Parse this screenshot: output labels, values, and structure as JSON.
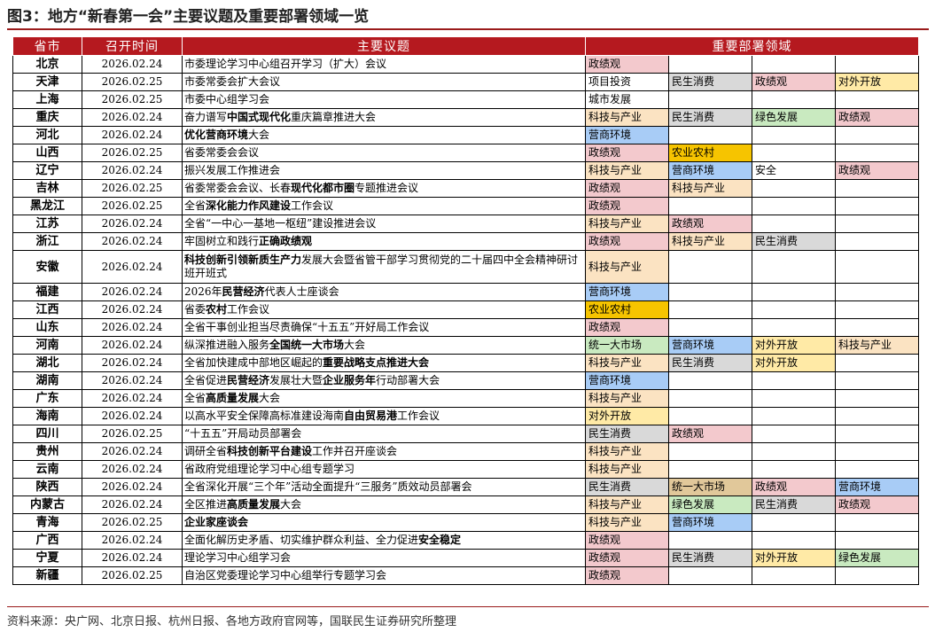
{
  "title": "图3：地方“新春第一会”主要议题及重要部署领域一览",
  "source": "资料来源：央广网、北京日报、杭州日报、各地方政府官网等，国联民生证券研究所整理",
  "headers": [
    "省市",
    "召开时间",
    "主要议题",
    "重要部署领域"
  ],
  "colors": {
    "header": "#b5191f",
    "rule": "#9a1b1b",
    "pink": "#f3c9cd",
    "orange": "#fbe3c2",
    "green": "#c9eac0",
    "blue": "#a8ccf6",
    "yellow": "#ffeaa6",
    "gray": "#d9d9d9",
    "gold": "#f6c400",
    "tan": "#e1c89a"
  },
  "rows": [
    {
      "prov": "北京",
      "date": "2026.02.24",
      "topic": [
        {
          "t": "市委理论学习中心组召开学习（扩大）会议"
        }
      ],
      "domains": [
        {
          "t": "政绩观",
          "c": "pink"
        },
        {
          "t": "",
          "c": "white"
        },
        {
          "t": "",
          "c": "white"
        },
        {
          "t": "",
          "c": "white"
        }
      ]
    },
    {
      "prov": "天津",
      "date": "2026.02.25",
      "topic": [
        {
          "t": "市委常委会扩大会议"
        }
      ],
      "domains": [
        {
          "t": "项目投资",
          "c": "white"
        },
        {
          "t": "民生消费",
          "c": "gray"
        },
        {
          "t": "政绩观",
          "c": "pink"
        },
        {
          "t": "对外开放",
          "c": "yellow"
        }
      ]
    },
    {
      "prov": "上海",
      "date": "2026.02.25",
      "topic": [
        {
          "t": "市委中心组学习会"
        }
      ],
      "domains": [
        {
          "t": "城市发展",
          "c": "white"
        },
        {
          "t": "",
          "c": "white"
        },
        {
          "t": "",
          "c": "white"
        },
        {
          "t": "",
          "c": "white"
        }
      ]
    },
    {
      "prov": "重庆",
      "date": "2026.02.24",
      "topic": [
        {
          "t": "奋力谱写"
        },
        {
          "t": "中国式现代化",
          "b": true
        },
        {
          "t": "重庆篇章推进大会"
        }
      ],
      "domains": [
        {
          "t": "科技与产业",
          "c": "orange"
        },
        {
          "t": "民生消费",
          "c": "gray"
        },
        {
          "t": "绿色发展",
          "c": "green"
        },
        {
          "t": "政绩观",
          "c": "pink"
        }
      ]
    },
    {
      "prov": "河北",
      "date": "2026.02.24",
      "topic": [
        {
          "t": "优化营商环境",
          "b": true
        },
        {
          "t": "大会"
        }
      ],
      "domains": [
        {
          "t": "营商环境",
          "c": "blue"
        },
        {
          "t": "",
          "c": "white"
        },
        {
          "t": "",
          "c": "white"
        },
        {
          "t": "",
          "c": "white"
        }
      ]
    },
    {
      "prov": "山西",
      "date": "2026.02.25",
      "topic": [
        {
          "t": "省委常委会会议"
        }
      ],
      "domains": [
        {
          "t": "政绩观",
          "c": "pink"
        },
        {
          "t": "农业农村",
          "c": "gold"
        },
        {
          "t": "",
          "c": "white"
        },
        {
          "t": "",
          "c": "white"
        }
      ]
    },
    {
      "prov": "辽宁",
      "date": "2026.02.24",
      "topic": [
        {
          "t": "振兴发展工作推进会"
        }
      ],
      "domains": [
        {
          "t": "科技与产业",
          "c": "orange"
        },
        {
          "t": "营商环境",
          "c": "blue"
        },
        {
          "t": "安全",
          "c": "white"
        },
        {
          "t": "政绩观",
          "c": "pink"
        }
      ]
    },
    {
      "prov": "吉林",
      "date": "2026.02.25",
      "topic": [
        {
          "t": "省委常委会会议、长春"
        },
        {
          "t": "现代化都市圈",
          "b": true
        },
        {
          "t": "专题推进会议"
        }
      ],
      "domains": [
        {
          "t": "政绩观",
          "c": "pink"
        },
        {
          "t": "科技与产业",
          "c": "orange"
        },
        {
          "t": "",
          "c": "white"
        },
        {
          "t": "",
          "c": "white"
        }
      ]
    },
    {
      "prov": "黑龙江",
      "date": "2026.02.25",
      "topic": [
        {
          "t": "全省"
        },
        {
          "t": "深化能力作风建设",
          "b": true
        },
        {
          "t": "工作会议"
        }
      ],
      "domains": [
        {
          "t": "政绩观",
          "c": "pink"
        },
        {
          "t": "",
          "c": "white"
        },
        {
          "t": "",
          "c": "white"
        },
        {
          "t": "",
          "c": "white"
        }
      ]
    },
    {
      "prov": "江苏",
      "date": "2026.02.24",
      "topic": [
        {
          "t": "全省“一中心一基地一枢纽”建设推进会议"
        }
      ],
      "domains": [
        {
          "t": "科技与产业",
          "c": "orange"
        },
        {
          "t": "政绩观",
          "c": "pink"
        },
        {
          "t": "",
          "c": "white"
        },
        {
          "t": "",
          "c": "white"
        }
      ]
    },
    {
      "prov": "浙江",
      "date": "2026.02.24",
      "topic": [
        {
          "t": "牢固树立和践行"
        },
        {
          "t": "正确政绩观",
          "b": true
        }
      ],
      "domains": [
        {
          "t": "政绩观",
          "c": "pink"
        },
        {
          "t": "科技与产业",
          "c": "orange"
        },
        {
          "t": "民生消费",
          "c": "gray"
        },
        {
          "t": "",
          "c": "white"
        }
      ]
    },
    {
      "prov": "安徽",
      "date": "2026.02.24",
      "tall": true,
      "topic": [
        {
          "t": "科技创新引领新质生产力",
          "b": true
        },
        {
          "t": "发展大会暨省管干部学习贯彻党的二十届四中全会精神研讨班开班式"
        }
      ],
      "domains": [
        {
          "t": "科技与产业",
          "c": "orange"
        },
        {
          "t": "",
          "c": "white"
        },
        {
          "t": "",
          "c": "white"
        },
        {
          "t": "",
          "c": "white"
        }
      ]
    },
    {
      "prov": "福建",
      "date": "2026.02.24",
      "topic": [
        {
          "t": "2026年"
        },
        {
          "t": "民营经济",
          "b": true
        },
        {
          "t": "代表人士座谈会"
        }
      ],
      "domains": [
        {
          "t": "营商环境",
          "c": "blue"
        },
        {
          "t": "",
          "c": "white"
        },
        {
          "t": "",
          "c": "white"
        },
        {
          "t": "",
          "c": "white"
        }
      ]
    },
    {
      "prov": "江西",
      "date": "2026.02.24",
      "topic": [
        {
          "t": "省委"
        },
        {
          "t": "农村",
          "b": true
        },
        {
          "t": "工作会议"
        }
      ],
      "domains": [
        {
          "t": "农业农村",
          "c": "gold"
        },
        {
          "t": "",
          "c": "white"
        },
        {
          "t": "",
          "c": "white"
        },
        {
          "t": "",
          "c": "white"
        }
      ]
    },
    {
      "prov": "山东",
      "date": "2026.02.24",
      "topic": [
        {
          "t": "全省干事创业担当尽责确保“十五五”开好局工作会议"
        }
      ],
      "domains": [
        {
          "t": "政绩观",
          "c": "pink"
        },
        {
          "t": "",
          "c": "white"
        },
        {
          "t": "",
          "c": "white"
        },
        {
          "t": "",
          "c": "white"
        }
      ]
    },
    {
      "prov": "河南",
      "date": "2026.02.24",
      "topic": [
        {
          "t": "纵深推进融入服务"
        },
        {
          "t": "全国统一大市场",
          "b": true
        },
        {
          "t": "大会"
        }
      ],
      "domains": [
        {
          "t": "统一大市场",
          "c": "green"
        },
        {
          "t": "营商环境",
          "c": "blue"
        },
        {
          "t": "对外开放",
          "c": "yellow"
        },
        {
          "t": "科技与产业",
          "c": "orange"
        }
      ]
    },
    {
      "prov": "湖北",
      "date": "2026.02.24",
      "topic": [
        {
          "t": "全省加快建成中部地区崛起的"
        },
        {
          "t": "重要战略支点推进大会",
          "b": true
        }
      ],
      "domains": [
        {
          "t": "科技与产业",
          "c": "orange"
        },
        {
          "t": "民生消费",
          "c": "gray"
        },
        {
          "t": "对外开放",
          "c": "yellow"
        },
        {
          "t": "",
          "c": "white"
        }
      ]
    },
    {
      "prov": "湖南",
      "date": "2026.02.24",
      "topic": [
        {
          "t": "全省促进"
        },
        {
          "t": "民营经济",
          "b": true
        },
        {
          "t": "发展壮大暨"
        },
        {
          "t": "企业服务年",
          "b": true
        },
        {
          "t": "行动部署大会"
        }
      ],
      "domains": [
        {
          "t": "营商环境",
          "c": "blue"
        },
        {
          "t": "",
          "c": "white"
        },
        {
          "t": "",
          "c": "white"
        },
        {
          "t": "",
          "c": "white"
        }
      ]
    },
    {
      "prov": "广东",
      "date": "2026.02.24",
      "topic": [
        {
          "t": "全省"
        },
        {
          "t": "高质量发展",
          "b": true
        },
        {
          "t": "大会"
        }
      ],
      "domains": [
        {
          "t": "科技与产业",
          "c": "orange"
        },
        {
          "t": "",
          "c": "white"
        },
        {
          "t": "",
          "c": "white"
        },
        {
          "t": "",
          "c": "white"
        }
      ]
    },
    {
      "prov": "海南",
      "date": "2026.02.24",
      "topic": [
        {
          "t": "以高水平安全保障高标准建设海南"
        },
        {
          "t": "自由贸易港",
          "b": true
        },
        {
          "t": "工作会议"
        }
      ],
      "domains": [
        {
          "t": "对外开放",
          "c": "yellow"
        },
        {
          "t": "",
          "c": "white"
        },
        {
          "t": "",
          "c": "white"
        },
        {
          "t": "",
          "c": "white"
        }
      ]
    },
    {
      "prov": "四川",
      "date": "2026.02.25",
      "topic": [
        {
          "t": "“十五五”开局动员部署会"
        }
      ],
      "domains": [
        {
          "t": "民生消费",
          "c": "gray"
        },
        {
          "t": "政绩观",
          "c": "pink"
        },
        {
          "t": "",
          "c": "white"
        },
        {
          "t": "",
          "c": "white"
        }
      ]
    },
    {
      "prov": "贵州",
      "date": "2026.02.24",
      "topic": [
        {
          "t": "调研全省"
        },
        {
          "t": "科技创新平台建设",
          "b": true
        },
        {
          "t": "工作并召开座谈会"
        }
      ],
      "domains": [
        {
          "t": "科技与产业",
          "c": "orange"
        },
        {
          "t": "",
          "c": "white"
        },
        {
          "t": "",
          "c": "white"
        },
        {
          "t": "",
          "c": "white"
        }
      ]
    },
    {
      "prov": "云南",
      "date": "2026.02.24",
      "topic": [
        {
          "t": "省政府党组理论学习中心组专题学习"
        }
      ],
      "domains": [
        {
          "t": "科技与产业",
          "c": "orange"
        },
        {
          "t": "",
          "c": "white"
        },
        {
          "t": "",
          "c": "white"
        },
        {
          "t": "",
          "c": "white"
        }
      ]
    },
    {
      "prov": "陕西",
      "date": "2026.02.24",
      "topic": [
        {
          "t": "全省深化开展“三个年”活动全面提升“三服务”质效动员部署会"
        }
      ],
      "domains": [
        {
          "t": "民生消费",
          "c": "gray"
        },
        {
          "t": "统一大市场",
          "c": "tan"
        },
        {
          "t": "政绩观",
          "c": "pink"
        },
        {
          "t": "营商环境",
          "c": "blue"
        }
      ]
    },
    {
      "prov": "内蒙古",
      "date": "2026.02.24",
      "topic": [
        {
          "t": "全区推进"
        },
        {
          "t": "高质量发展",
          "b": true
        },
        {
          "t": "大会"
        }
      ],
      "domains": [
        {
          "t": "科技与产业",
          "c": "orange"
        },
        {
          "t": "绿色发展",
          "c": "green"
        },
        {
          "t": "民生消费",
          "c": "gray"
        },
        {
          "t": "政绩观",
          "c": "pink"
        }
      ]
    },
    {
      "prov": "青海",
      "date": "2026.02.25",
      "topic": [
        {
          "t": "企业家座谈会",
          "b": true
        }
      ],
      "domains": [
        {
          "t": "科技与产业",
          "c": "orange"
        },
        {
          "t": "营商环境",
          "c": "blue"
        },
        {
          "t": "",
          "c": "white"
        },
        {
          "t": "",
          "c": "white"
        }
      ]
    },
    {
      "prov": "广西",
      "date": "2026.02.24",
      "topic": [
        {
          "t": "全面化解历史矛盾、切实维护群众利益、全力促进"
        },
        {
          "t": "安全稳定",
          "b": true
        }
      ],
      "domains": [
        {
          "t": "政绩观",
          "c": "pink"
        },
        {
          "t": "",
          "c": "white"
        },
        {
          "t": "",
          "c": "white"
        },
        {
          "t": "",
          "c": "white"
        }
      ]
    },
    {
      "prov": "宁夏",
      "date": "2026.02.24",
      "topic": [
        {
          "t": "理论学习中心组学习会"
        }
      ],
      "domains": [
        {
          "t": "政绩观",
          "c": "pink"
        },
        {
          "t": "民生消费",
          "c": "gray"
        },
        {
          "t": "对外开放",
          "c": "yellow"
        },
        {
          "t": "绿色发展",
          "c": "green"
        }
      ]
    },
    {
      "prov": "新疆",
      "date": "2026.02.25",
      "topic": [
        {
          "t": "自治区党委理论学习中心组举行专题学习会"
        }
      ],
      "domains": [
        {
          "t": "政绩观",
          "c": "pink"
        },
        {
          "t": "",
          "c": "white"
        },
        {
          "t": "",
          "c": "white"
        },
        {
          "t": "",
          "c": "white"
        }
      ]
    }
  ]
}
